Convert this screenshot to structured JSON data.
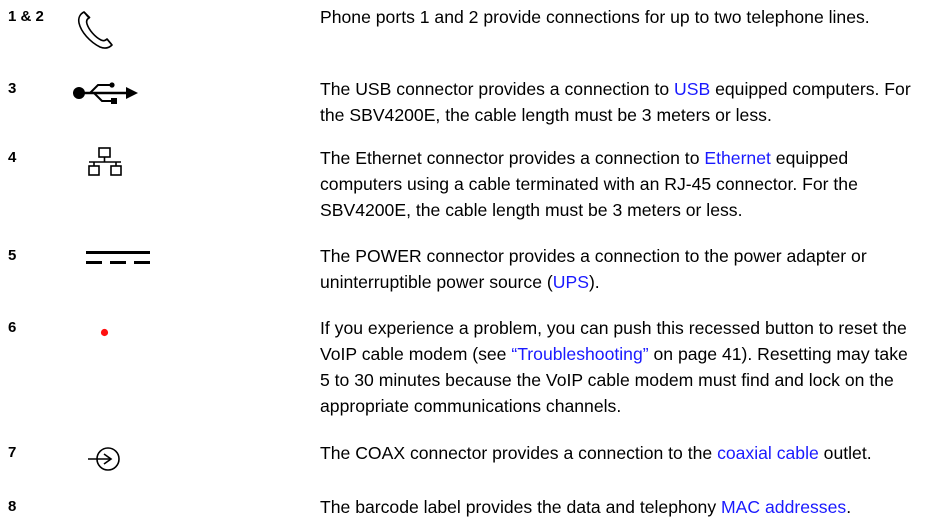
{
  "rows": [
    {
      "number": "1 & 2",
      "icon": "phone-icon",
      "lines": [
        [
          {
            "t": "Phone ports 1 and 2 provide connections for up to two telephone lines."
          }
        ]
      ]
    },
    {
      "number": "3",
      "icon": "usb-icon",
      "lines": [
        [
          {
            "t": "The USB connector provides a connection to "
          },
          {
            "t": "USB",
            "link": true
          },
          {
            "t": " equipped computers. For"
          }
        ],
        [
          {
            "t": "the SBV4200E, the cable length must be 3 meters or less."
          }
        ]
      ]
    },
    {
      "number": "4",
      "icon": "ethernet-icon",
      "lines": [
        [
          {
            "t": "The Ethernet connector provides a connection to "
          },
          {
            "t": "Ethernet",
            "link": true
          },
          {
            "t": " equipped"
          }
        ],
        [
          {
            "t": "computers using a cable terminated with an RJ-45 connector. For the"
          }
        ],
        [
          {
            "t": "SBV4200E, the cable length must be 3 meters or less."
          }
        ]
      ]
    },
    {
      "number": "5",
      "icon": "dc-power-icon",
      "lines": [
        [
          {
            "t": "The POWER connector provides a connection to the power adapter or"
          }
        ],
        [
          {
            "t": "uninterruptible power source ("
          },
          {
            "t": "UPS",
            "link": true
          },
          {
            "t": ")."
          }
        ]
      ]
    },
    {
      "number": "6",
      "icon": "reset-dot-icon",
      "lines": [
        [
          {
            "t": "If you experience a problem, you can push this recessed button to reset the"
          }
        ],
        [
          {
            "t": "VoIP cable modem (see "
          },
          {
            "t": "“Troubleshooting”",
            "link": true
          },
          {
            "t": " on page 41). Resetting may take"
          }
        ],
        [
          {
            "t": "5 to 30 minutes because the VoIP cable modem must find and lock on the"
          }
        ],
        [
          {
            "t": "appropriate communications channels."
          }
        ]
      ]
    },
    {
      "number": "7",
      "icon": "coax-icon",
      "lines": [
        [
          {
            "t": "The COAX connector provides a connection to the "
          },
          {
            "t": "coaxial cable",
            "link": true
          },
          {
            "t": " outlet."
          }
        ]
      ]
    },
    {
      "number": "8",
      "icon": "",
      "lines": [
        [
          {
            "t": "The barcode label provides the data and telephony "
          },
          {
            "t": "MAC addresses",
            "link": true
          },
          {
            "t": "."
          }
        ]
      ]
    }
  ],
  "colors": {
    "link": "#1a1aff",
    "reset_dot": "#ff1010",
    "text": "#000000"
  }
}
